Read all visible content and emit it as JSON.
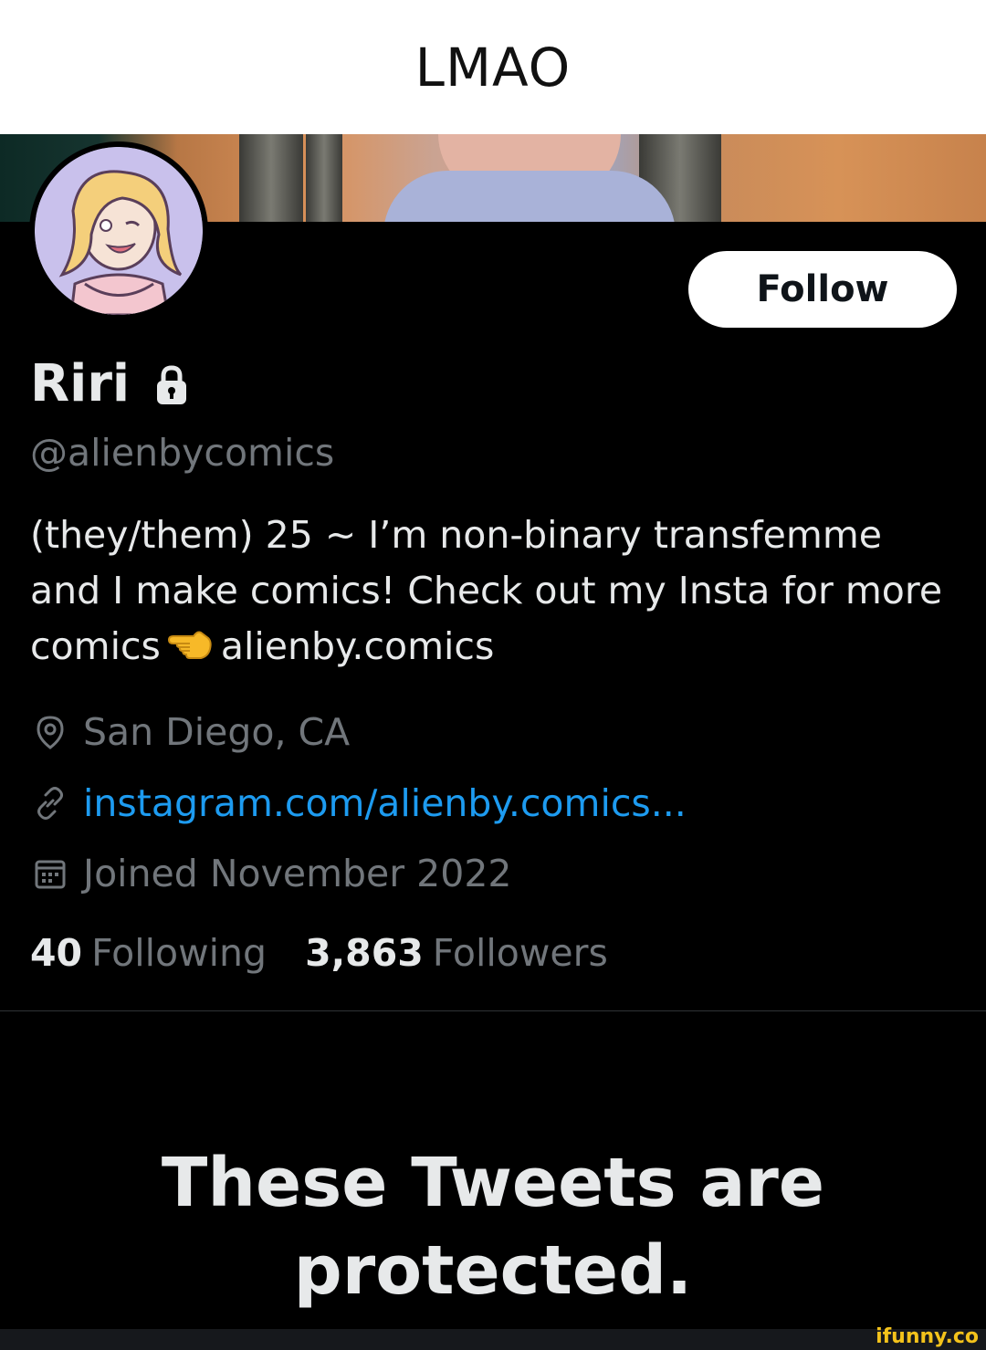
{
  "caption": "LMAO",
  "profile": {
    "display_name": "Riri",
    "handle": "@alienbycomics",
    "follow_label": "Follow",
    "bio": {
      "line1": "(they/them) 25 ~ I’m non-binary transfemme",
      "line2": "and I make comics! Check out my Insta for more",
      "line3_before": "comics",
      "line3_after": "alienby.comics"
    },
    "location": "San Diego, CA",
    "website": "instagram.com/alienby.comics...",
    "joined": "Joined November 2022",
    "following_count": "40",
    "following_label": "Following",
    "followers_count": "3,863",
    "followers_label": "Followers"
  },
  "protected_message": {
    "line1": "These Tweets are",
    "line2": "protected."
  },
  "watermark": "ifunny.co",
  "icons": {
    "lock": "lock-icon",
    "location": "location-pin-icon",
    "link": "link-icon",
    "calendar": "calendar-icon",
    "pointing": "backhand-index-pointing-left-emoji"
  },
  "colors": {
    "background": "#000000",
    "primary_text": "#e7e9ea",
    "secondary_text": "#71767b",
    "link": "#1d9bf0",
    "button_bg": "#ffffff"
  }
}
